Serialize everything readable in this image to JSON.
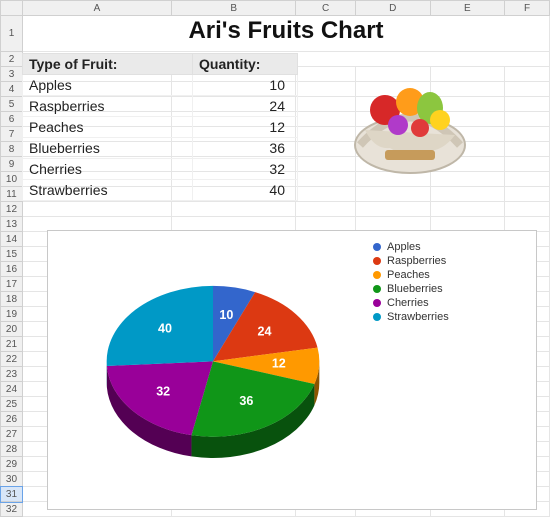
{
  "columns": [
    "A",
    "B",
    "C",
    "D",
    "E",
    "F"
  ],
  "title": "Ari's Fruits Chart",
  "headers": {
    "fruit": "Type of Fruit:",
    "qty": "Quantity:"
  },
  "rows": [
    {
      "fruit": "Apples",
      "qty": 10
    },
    {
      "fruit": "Raspberries",
      "qty": 24
    },
    {
      "fruit": "Peaches",
      "qty": 12
    },
    {
      "fruit": "Blueberries",
      "qty": 36
    },
    {
      "fruit": "Cherries",
      "qty": 32
    },
    {
      "fruit": "Strawberries",
      "qty": 40
    }
  ],
  "chart_data": {
    "type": "pie",
    "title": "",
    "categories": [
      "Apples",
      "Raspberries",
      "Peaches",
      "Blueberries",
      "Cherries",
      "Strawberries"
    ],
    "values": [
      10,
      24,
      12,
      36,
      32,
      40
    ],
    "colors": [
      "#3366cc",
      "#dc3912",
      "#ff9900",
      "#109618",
      "#990099",
      "#0099c6"
    ],
    "legend_position": "right"
  }
}
